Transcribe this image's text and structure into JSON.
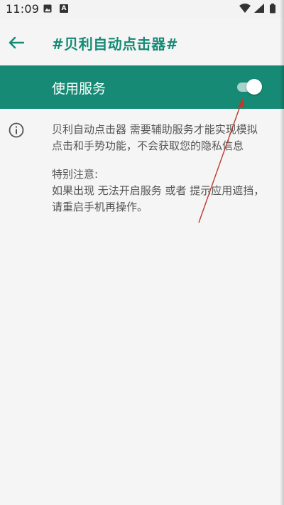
{
  "status_bar": {
    "time": "11:09",
    "icons": [
      "image-icon",
      "a-icon",
      "wifi-icon",
      "signal-icon",
      "battery-icon"
    ]
  },
  "toolbar": {
    "title": "#贝利自动点击器#",
    "back_icon": "back-arrow-icon"
  },
  "service": {
    "label": "使用服务",
    "enabled": true
  },
  "info": {
    "icon": "info-icon",
    "description": "贝利自动点击器 需要辅助服务才能实现模拟点击和手势功能，不会获取您的隐私信息",
    "notice_title": "特别注意:",
    "notice_body": "如果出现 无法开启服务 或者 提示应用遮挡，请重启手机再操作。"
  },
  "colors": {
    "primary": "#168a75",
    "background": "#f5f5f5",
    "toggle_track": "#a6d3ca",
    "annotation": "#c0392b"
  }
}
